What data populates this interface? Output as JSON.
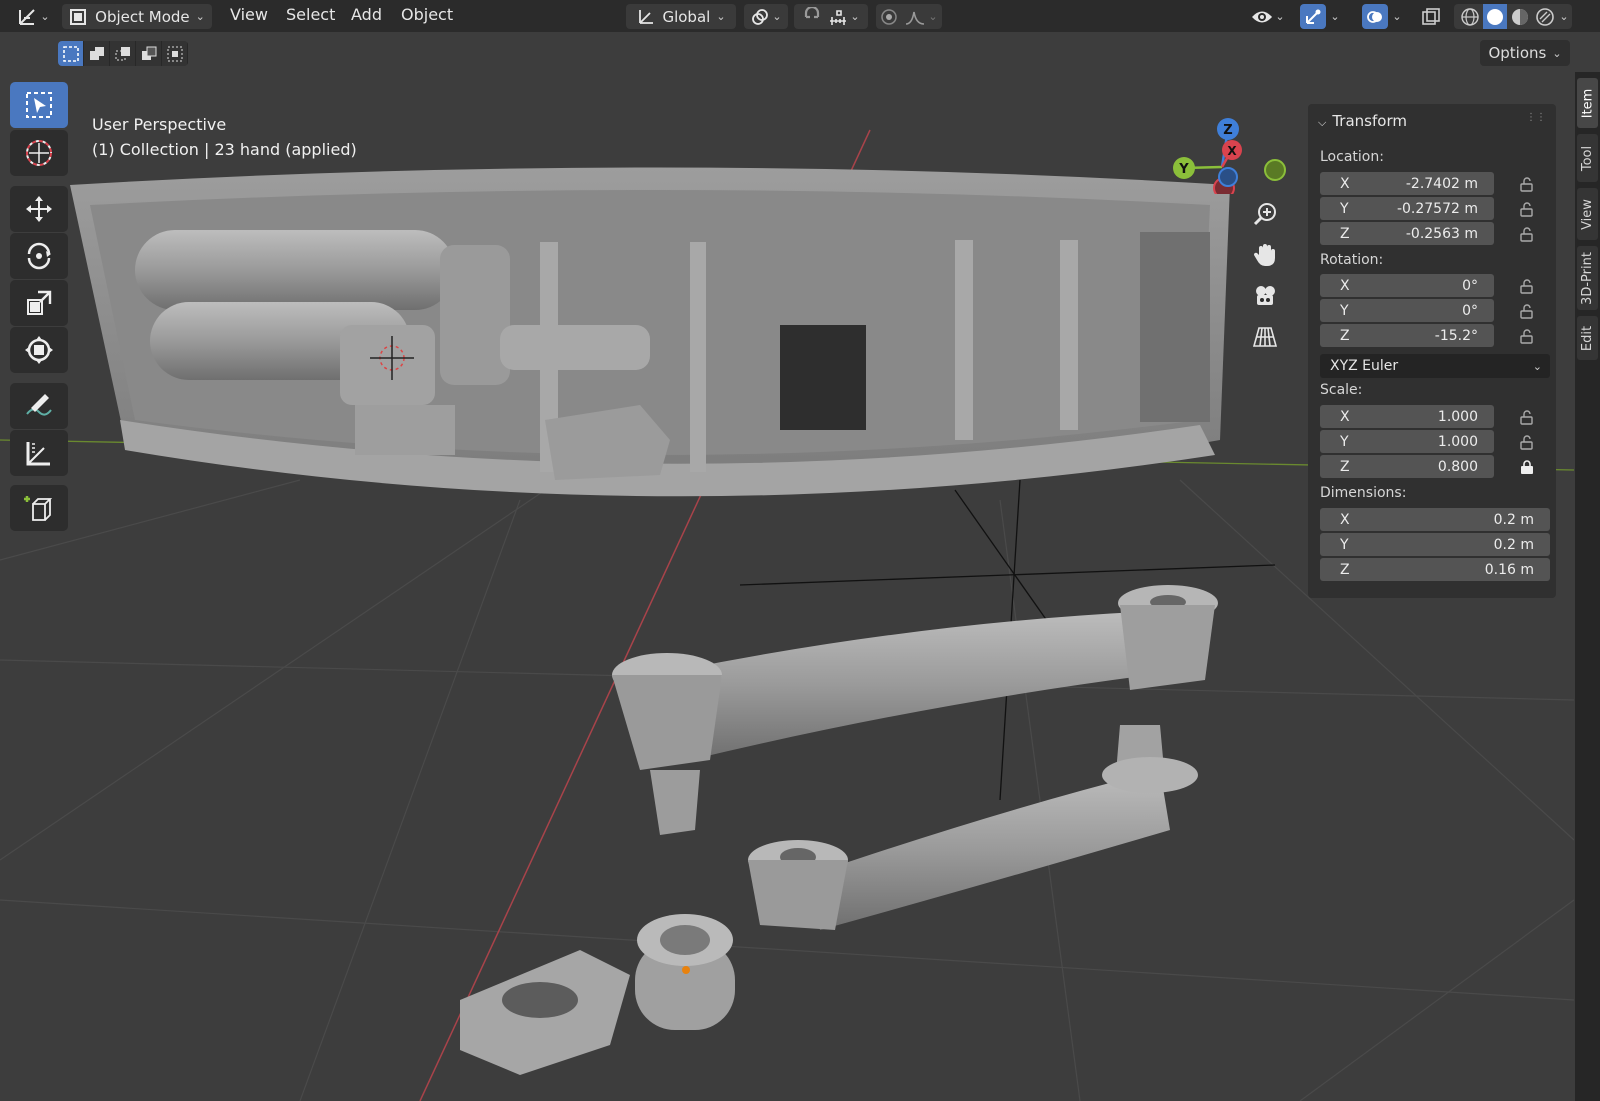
{
  "header": {
    "editor_type_icon": "viewport-axes-icon",
    "mode": "Object Mode",
    "menus": [
      "View",
      "Select",
      "Add",
      "Object"
    ],
    "transform_orientation": "Global",
    "options_label": "Options"
  },
  "viewport": {
    "perspective_label": "User Perspective",
    "collection_label": "(1) Collection | 23 hand (applied)",
    "gizmo_axes": [
      "Z",
      "Y",
      "X"
    ]
  },
  "transform": {
    "title": "Transform",
    "location_label": "Location:",
    "location": [
      {
        "axis": "X",
        "value": "-2.7402 m"
      },
      {
        "axis": "Y",
        "value": "-0.27572 m"
      },
      {
        "axis": "Z",
        "value": "-0.2563 m"
      }
    ],
    "rotation_label": "Rotation:",
    "rotation": [
      {
        "axis": "X",
        "value": "0°"
      },
      {
        "axis": "Y",
        "value": "0°"
      },
      {
        "axis": "Z",
        "value": "-15.2°"
      }
    ],
    "rotation_mode": "XYZ Euler",
    "scale_label": "Scale:",
    "scale": [
      {
        "axis": "X",
        "value": "1.000"
      },
      {
        "axis": "Y",
        "value": "1.000"
      },
      {
        "axis": "Z",
        "value": "0.800"
      }
    ],
    "dimensions_label": "Dimensions:",
    "dimensions": [
      {
        "axis": "X",
        "value": "0.2 m"
      },
      {
        "axis": "Y",
        "value": "0.2 m"
      },
      {
        "axis": "Z",
        "value": "0.16 m"
      }
    ]
  },
  "sidebar_tabs": [
    "Item",
    "Tool",
    "View",
    "3D-Print",
    "Edit"
  ],
  "colors": {
    "accent": "#4a78c0",
    "axis_x": "#d9434e",
    "axis_y": "#8bbf3a",
    "axis_z": "#3f7fd9",
    "panel_bg": "#303030",
    "viewport_bg": "#3d3d3d"
  }
}
